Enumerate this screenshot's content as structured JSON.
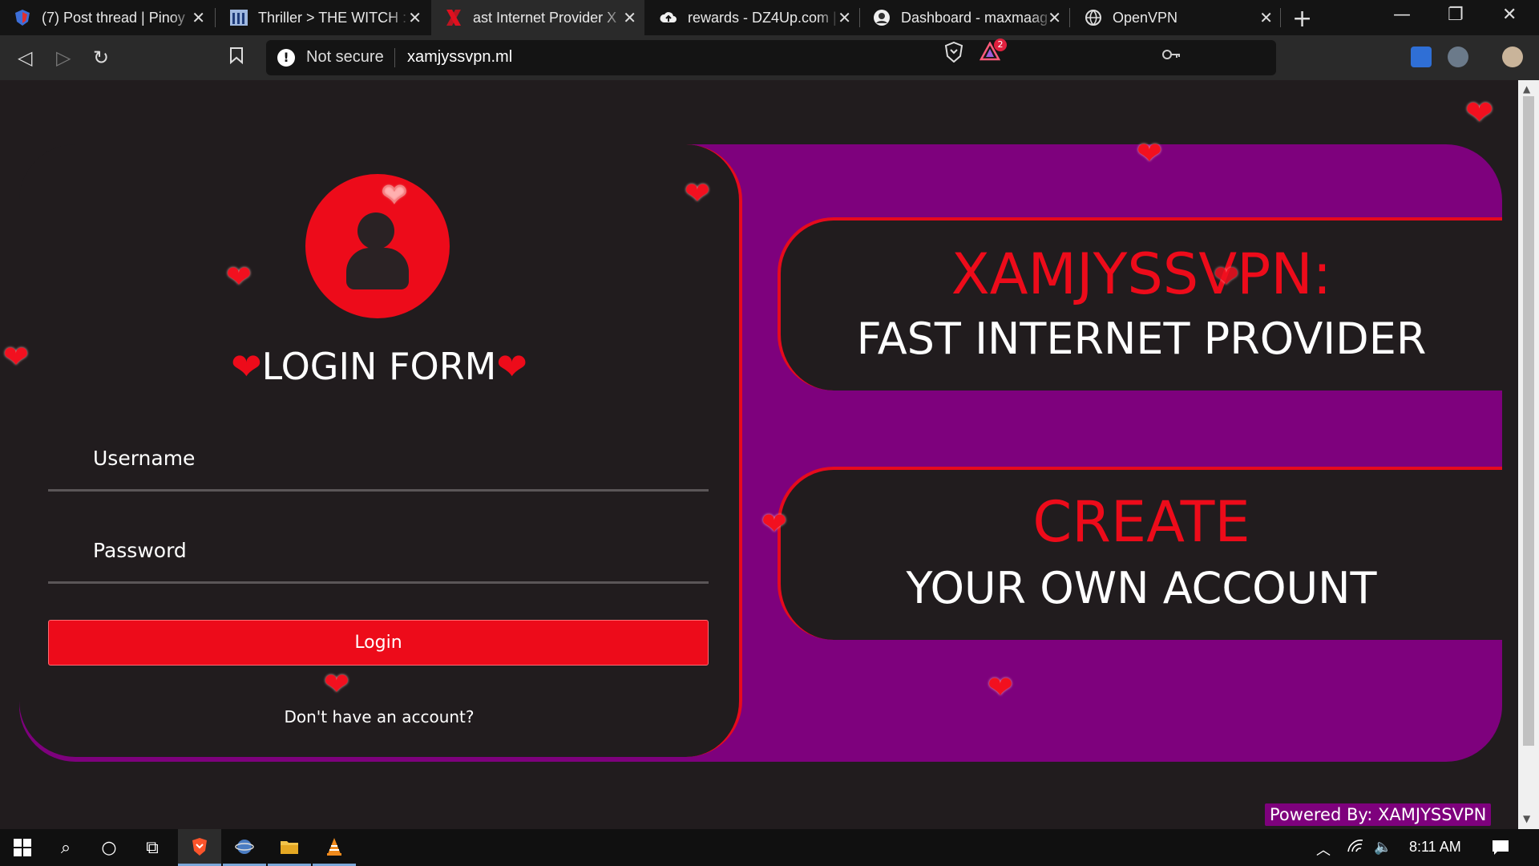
{
  "browser": {
    "tabs": [
      {
        "title": "(7) Post thread | Pinoy",
        "active": false
      },
      {
        "title": "Thriller > THE WITCH :",
        "active": false
      },
      {
        "title": "ast Internet Provider X",
        "active": true
      },
      {
        "title": "rewards - DZ4Up.com |",
        "active": false
      },
      {
        "title": "Dashboard - maxmaag",
        "active": false
      },
      {
        "title": "OpenVPN",
        "active": false
      }
    ],
    "tab_close": "✕",
    "new_tab": "+",
    "security_label": "Not secure",
    "url": "xamjyssvpn.ml",
    "rewards_badge": "2"
  },
  "login": {
    "title": "LOGIN FORM",
    "heart_glyph": "❤",
    "username_placeholder": "Username",
    "password_placeholder": "Password",
    "button_label": "Login",
    "signup_text": "Don't have an account?"
  },
  "promo": {
    "brand": "XAMJYSSVPN:",
    "tagline": "FAST INTERNET PROVIDER",
    "create": "CREATE",
    "create_sub": "YOUR OWN ACCOUNT"
  },
  "footer": {
    "powered_by": "Powered By: XAMJYSSVPN"
  },
  "taskbar": {
    "clock": "8:11 AM"
  },
  "colors": {
    "accent_red": "#ed0b1a",
    "purple": "#7e017d",
    "page_bg": "#211c1e"
  }
}
